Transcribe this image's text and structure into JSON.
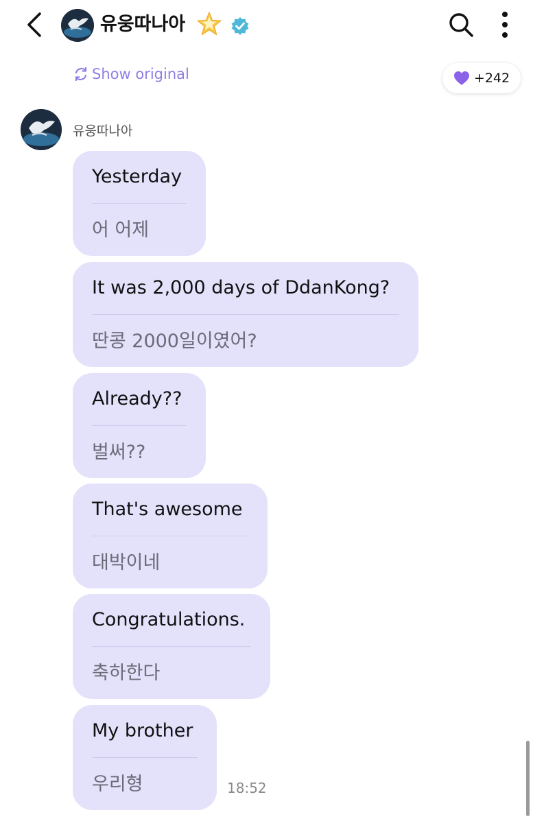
{
  "header": {
    "title": "유웅따나아",
    "icons": [
      "back-icon",
      "avatar",
      "star-icon",
      "verified-icon",
      "search-icon",
      "more-icon"
    ]
  },
  "toolbar": {
    "show_original_label": "Show original",
    "likes_label": "+242"
  },
  "colors": {
    "accent": "#8e7fe6",
    "bubble_bg": "#e4e1fb",
    "heart": "#8b63e8",
    "verified": "#4fb8d8"
  },
  "conversation": {
    "sender_name": "유웅따나아",
    "messages": [
      {
        "translation": "Yesterday",
        "original": "어 어제"
      },
      {
        "translation": "It was 2,000 days of DdanKong?",
        "original": "딴콩 2000일이였어?"
      },
      {
        "translation": "Already??",
        "original": "벌써??"
      },
      {
        "translation": "That's awesome",
        "original": "대박이네"
      },
      {
        "translation": "Congratulations.",
        "original": "축하한다"
      },
      {
        "translation": "My brother",
        "original": "우리형"
      }
    ],
    "last_time": "18:52"
  }
}
